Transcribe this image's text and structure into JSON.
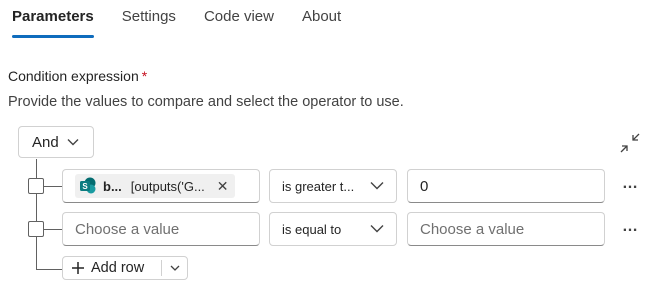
{
  "tabs": [
    {
      "label": "Parameters"
    },
    {
      "label": "Settings"
    },
    {
      "label": "Code view"
    },
    {
      "label": "About"
    }
  ],
  "condition": {
    "label": "Condition expression",
    "required_mark": "*",
    "description": "Provide the values to compare and select the operator to use."
  },
  "group": {
    "operator": "And"
  },
  "rows": [
    {
      "left": {
        "token_bold": "b...",
        "token_text": "[outputs('G...",
        "token_icon": "sharepoint-icon"
      },
      "operator": "is greater t...",
      "right": {
        "value": "0"
      }
    },
    {
      "left": {
        "placeholder": "Choose a value"
      },
      "operator": "is equal to",
      "right": {
        "placeholder": "Choose a value"
      }
    }
  ],
  "actions": {
    "add_row": "Add row",
    "more": "…"
  },
  "colors": {
    "accent": "#0f6cbd",
    "required": "#c50f1f",
    "sharepoint": "#0b7c80"
  }
}
